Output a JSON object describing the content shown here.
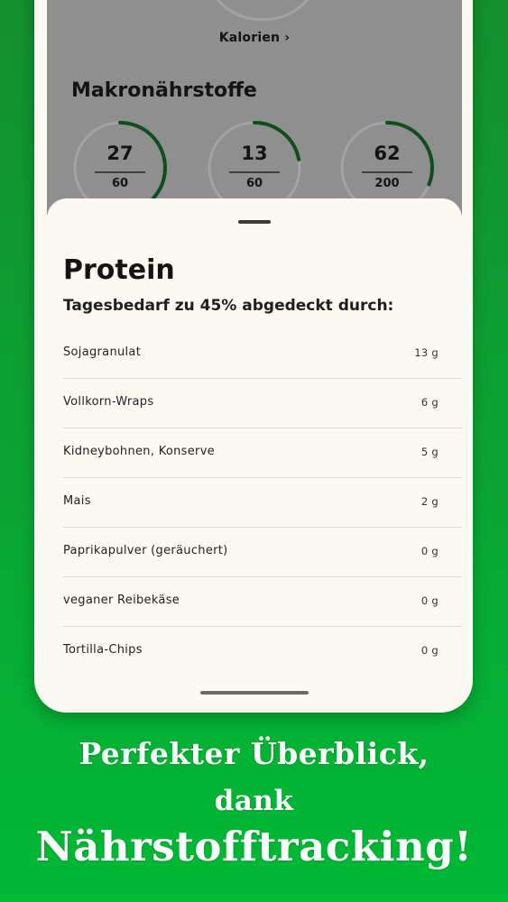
{
  "header": {
    "calories_link": "Kalorien ›"
  },
  "macros": {
    "title": "Makronährstoffe",
    "items": [
      {
        "value": "27",
        "goal": "60",
        "fraction": 0.45
      },
      {
        "value": "13",
        "goal": "60",
        "fraction": 0.22
      },
      {
        "value": "62",
        "goal": "200",
        "fraction": 0.31
      }
    ],
    "ring_color": "#104d1e",
    "track_color": "#a3a3a3"
  },
  "sheet": {
    "title": "Protein",
    "subtitle": "Tagesbedarf zu 45% abgedeckt durch:",
    "items": [
      {
        "name": "Sojagranulat",
        "amount": "13 g"
      },
      {
        "name": "Vollkorn-Wraps",
        "amount": "6 g"
      },
      {
        "name": "Kidneybohnen, Konserve",
        "amount": "5 g"
      },
      {
        "name": "Mais",
        "amount": "2 g"
      },
      {
        "name": "Paprikapulver (geräuchert)",
        "amount": "0 g"
      },
      {
        "name": "veganer Reibekäse",
        "amount": "0 g"
      },
      {
        "name": "Tortilla-Chips",
        "amount": "0 g"
      }
    ]
  },
  "caption": {
    "line1": "Perfekter Überblick,",
    "line2": "dank",
    "line3": "Nährstofftracking!"
  }
}
